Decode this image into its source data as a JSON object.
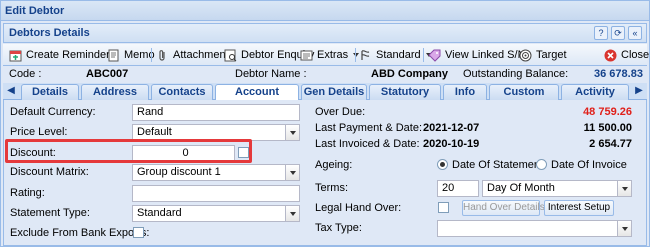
{
  "window": {
    "title": "Edit Debtor"
  },
  "panel": {
    "title": "Debtors Details"
  },
  "toolbar": {
    "create_reminder": "Create Reminder",
    "memo": "Memo",
    "attachment": "Attachment",
    "debtor_enquiry": "Debtor Enquiry",
    "extras": "Extras",
    "standard": "Standard",
    "view_linked": "View Linked S/N",
    "target": "Target",
    "close": "Close"
  },
  "info": {
    "code_label": "Code :",
    "code_value": "ABC007",
    "name_label": "Debtor Name :",
    "name_value": "ABD Company",
    "balance_label": "Outstanding Balance:",
    "balance_value": "36 678.83"
  },
  "tabs": [
    "Details",
    "Address",
    "Contacts",
    "Account Details",
    "Gen Details",
    "Statutory",
    "Info",
    "Custom Fields",
    "Activity"
  ],
  "left": {
    "currency_label": "Default Currency:",
    "currency_value": "Rand",
    "price_label": "Price Level:",
    "price_value": "Default",
    "discount_label": "Discount:",
    "discount_value": "0",
    "matrix_label": "Discount Matrix:",
    "matrix_value": "Group discount 1",
    "rating_label": "Rating:",
    "rating_value": "",
    "stmt_type_label": "Statement Type:",
    "stmt_type_value": "Standard",
    "exclude_label": "Exclude From Bank Exports:"
  },
  "right": {
    "overdue_label": "Over Due:",
    "overdue_value": "48 759.26",
    "last_payment_label": "Last Payment & Date:",
    "last_payment_date": "2021-12-07",
    "last_payment_value": "11 500.00",
    "last_invoiced_label": "Last Invoiced & Date:",
    "last_invoiced_date": "2020-10-19",
    "last_invoiced_value": "2 654.77",
    "ageing_label": "Ageing:",
    "ageing_opt1": "Date Of Statement",
    "ageing_opt2": "Date Of Invoice",
    "terms_label": "Terms:",
    "terms_days": "20",
    "terms_type": "Day Of Month",
    "legal_label": "Legal Hand Over:",
    "hand_over_btn": "Hand Over Details",
    "interest_btn": "Interest Setup",
    "tax_label": "Tax Type:",
    "tax_value": ""
  }
}
